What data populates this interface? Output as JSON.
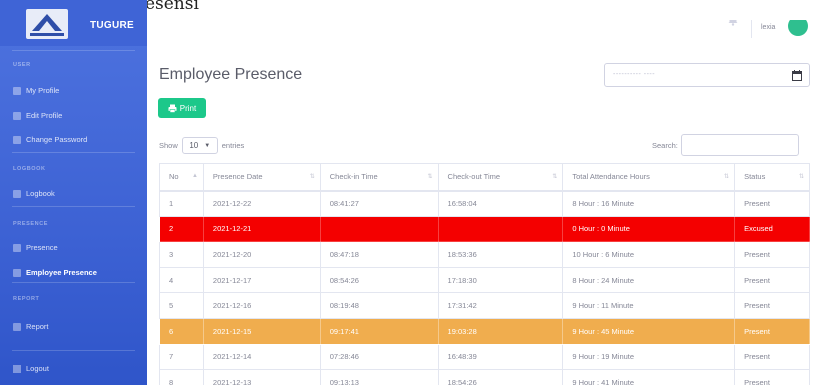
{
  "page_header": {
    "title": "i Rekapitulasi Presensi"
  },
  "brand": {
    "name": "TUGURE"
  },
  "colors": {
    "sidebar": "#4e73df",
    "print_button": "#1cc88a",
    "excused_row": "#f40000",
    "highlight_row": "#f0ad4e",
    "avatar": "#2fbf8f"
  },
  "sidebar": {
    "sections": [
      {
        "heading": "USER",
        "items": [
          {
            "label": "My Profile",
            "icon": "user-icon"
          },
          {
            "label": "Edit Profile",
            "icon": "user-edit-icon"
          },
          {
            "label": "Change Password",
            "icon": "key-icon"
          }
        ]
      },
      {
        "heading": "LOGBOOK",
        "items": [
          {
            "label": "Logbook",
            "icon": "book-icon"
          }
        ]
      },
      {
        "heading": "PRESENCE",
        "items": [
          {
            "label": "Presence",
            "icon": "calendar-icon"
          },
          {
            "label": "Employee Presence",
            "icon": "calendar-check-icon",
            "active": true
          }
        ]
      },
      {
        "heading": "REPORT",
        "items": [
          {
            "label": "Report",
            "icon": "chart-icon"
          }
        ]
      }
    ],
    "logout": {
      "label": "Logout",
      "icon": "logout-icon"
    }
  },
  "topbar": {
    "notification_count": "0",
    "user_name": "lexia"
  },
  "main": {
    "title": "Employee Presence",
    "date_placeholder": "---------- ----",
    "print_label": "Print",
    "show_label": "Show",
    "entries_value": "10",
    "entries_label": "entries",
    "search_label": "Search:"
  },
  "table": {
    "columns": [
      "No",
      "Presence Date",
      "Check-in Time",
      "Check-out Time",
      "Total Attendance Hours",
      "Status"
    ],
    "rows": [
      {
        "no": "1",
        "date": "2021-12-22",
        "in": "08:41:27",
        "out": "16:58:04",
        "hours": "8 Hour : 16 Minute",
        "status": "Present"
      },
      {
        "no": "2",
        "date": "2021-12-21",
        "in": "",
        "out": "",
        "hours": "0 Hour : 0 Minute",
        "status": "Excused",
        "style": "excused"
      },
      {
        "no": "3",
        "date": "2021-12-20",
        "in": "08:47:18",
        "out": "18:53:36",
        "hours": "10 Hour : 6 Minute",
        "status": "Present"
      },
      {
        "no": "4",
        "date": "2021-12-17",
        "in": "08:54:26",
        "out": "17:18:30",
        "hours": "8 Hour : 24 Minute",
        "status": "Present"
      },
      {
        "no": "5",
        "date": "2021-12-16",
        "in": "08:19:48",
        "out": "17:31:42",
        "hours": "9 Hour : 11 Minute",
        "status": "Present"
      },
      {
        "no": "6",
        "date": "2021-12-15",
        "in": "09:17:41",
        "out": "19:03:28",
        "hours": "9 Hour : 45 Minute",
        "status": "Present",
        "style": "highlight"
      },
      {
        "no": "7",
        "date": "2021-12-14",
        "in": "07:28:46",
        "out": "16:48:39",
        "hours": "9 Hour : 19 Minute",
        "status": "Present"
      },
      {
        "no": "8",
        "date": "2021-12-13",
        "in": "09:13:13",
        "out": "18:54:26",
        "hours": "9 Hour : 41 Minute",
        "status": "Present"
      }
    ]
  }
}
